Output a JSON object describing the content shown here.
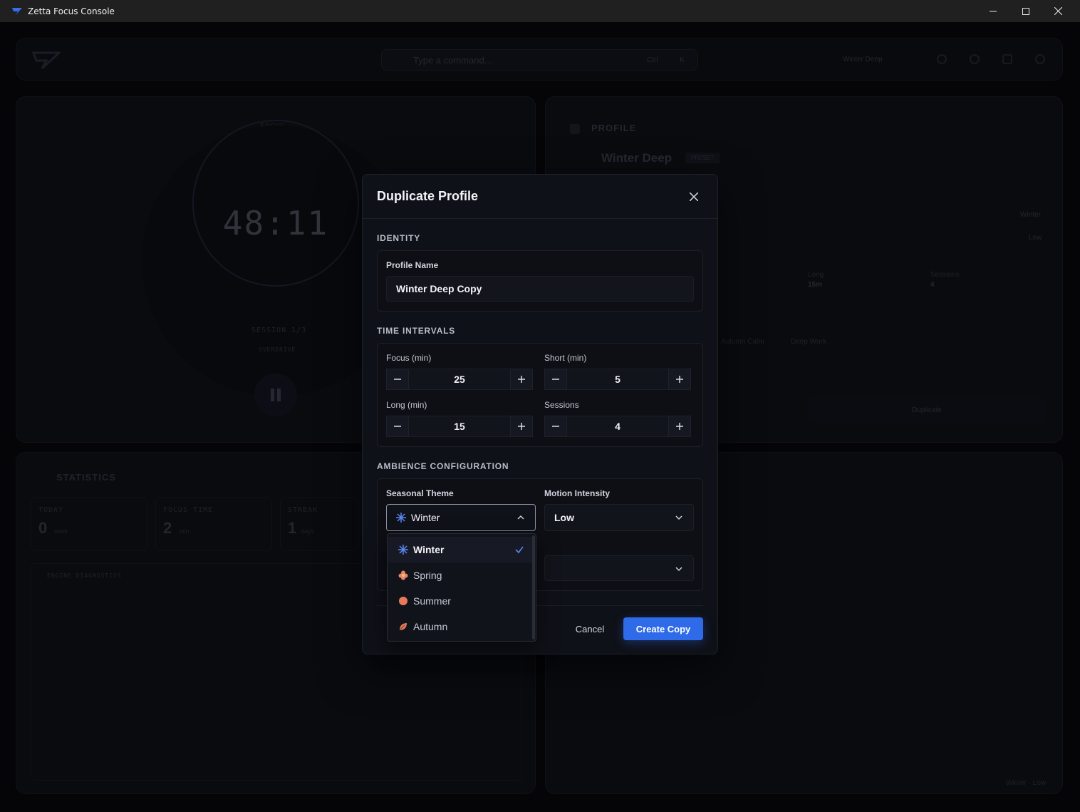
{
  "window": {
    "title": "Zetta Focus Console"
  },
  "background": {
    "command_placeholder": "Type a command...",
    "command_shortcut": "Ctrl",
    "command_key": "K",
    "active_profile_chip": "Winter Deep",
    "timer_label": "FOCUS",
    "timer_value": "48:11",
    "session_text": "SESSION 1/3",
    "overdrive_text": "OVERDRIVE",
    "profile_title": "PROFILE",
    "profile_name": "Winter Deep",
    "profile_badge": "PRESET",
    "statistics_title": "STATISTICS",
    "stat_today_label": "TODAY",
    "stat_today_value": "0",
    "stat_today_unit": "sess",
    "stat_focus_label": "FOCUS TIME",
    "stat_focus_value": "2",
    "stat_focus_unit": "min",
    "stat_streak_label": "STREAK",
    "stat_streak_value": "1",
    "stat_streak_unit": "days",
    "diagnostics_title": "ENGINE DIAGNOSTICS",
    "right_theme": "Winter",
    "right_intensity": "Low",
    "long_label": "Long",
    "long_value": "15m",
    "sessions_label": "Sessions",
    "sessions_value": "4",
    "tag_autumn": "Autumn Calm",
    "tag_deep": "Deep Work",
    "duplicate_btn": "Duplicate",
    "corner_status": "Winter · Low"
  },
  "modal": {
    "title": "Duplicate Profile",
    "identity": {
      "section": "IDENTITY",
      "name_label": "Profile Name",
      "name_value": "Winter Deep Copy"
    },
    "intervals": {
      "section": "TIME INTERVALS",
      "focus_label": "Focus (min)",
      "focus_value": "25",
      "short_label": "Short (min)",
      "short_value": "5",
      "long_label": "Long (min)",
      "long_value": "15",
      "sessions_label": "Sessions",
      "sessions_value": "4"
    },
    "ambience": {
      "section": "AMBIENCE CONFIGURATION",
      "theme_label": "Seasonal Theme",
      "theme_value": "Winter",
      "motion_label": "Motion Intensity",
      "motion_value": "Low",
      "theme_options": [
        "Winter",
        "Spring",
        "Summer",
        "Autumn"
      ]
    },
    "cancel_label": "Cancel",
    "create_label": "Create Copy"
  },
  "colors": {
    "accent": "#2f6be8",
    "winter": "#5b86f0",
    "spring": "#e8866a",
    "summer": "#e87a5a",
    "autumn": "#e07a55"
  }
}
